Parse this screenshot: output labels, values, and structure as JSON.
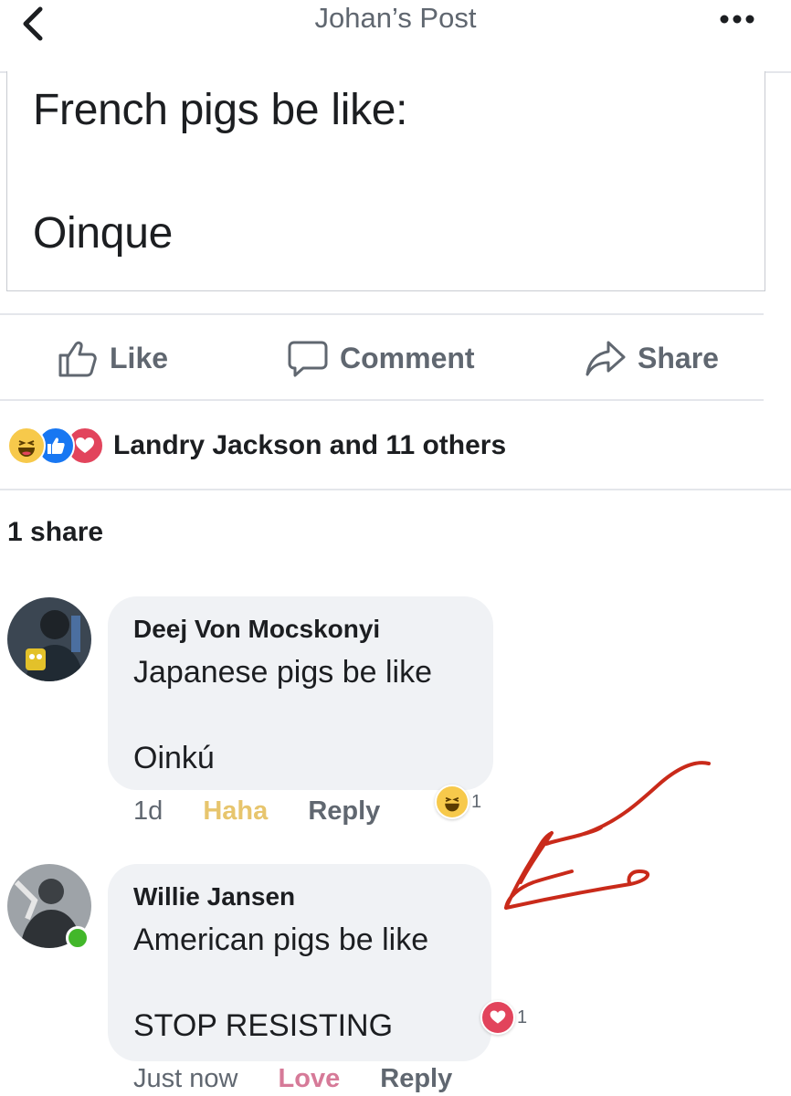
{
  "header": {
    "title": "Johan’s Post",
    "back_icon": "chevron-left-icon",
    "more_icon": "more-dots-icon"
  },
  "post": {
    "line1": "French pigs be like:",
    "line2": "Oinque"
  },
  "actions": {
    "like": "Like",
    "comment": "Comment",
    "share": "Share"
  },
  "reactions": {
    "icons": [
      "haha-icon",
      "like-icon",
      "love-icon"
    ],
    "text": "Landry Jackson and 11 others"
  },
  "shares": "1 share",
  "comments": [
    {
      "author": "Deej Von Mocskonyi",
      "line1": "Japanese pigs be like",
      "line2": "Oinkú",
      "time": "1d",
      "reaction_label": "Haha",
      "reply": "Reply",
      "badge_icon": "haha-icon",
      "badge_count": "1"
    },
    {
      "author": "Willie Jansen",
      "line1": "American pigs be like",
      "line2": "STOP RESISTING",
      "time": "Just now",
      "reaction_label": "Love",
      "reply": "Reply",
      "badge_icon": "love-icon",
      "badge_count": "1",
      "online": true
    }
  ],
  "colors": {
    "haha": "#f7c94b",
    "like": "#1877f2",
    "love": "#e2445c",
    "online": "#42b72a",
    "annotation": "#c92a1a"
  }
}
